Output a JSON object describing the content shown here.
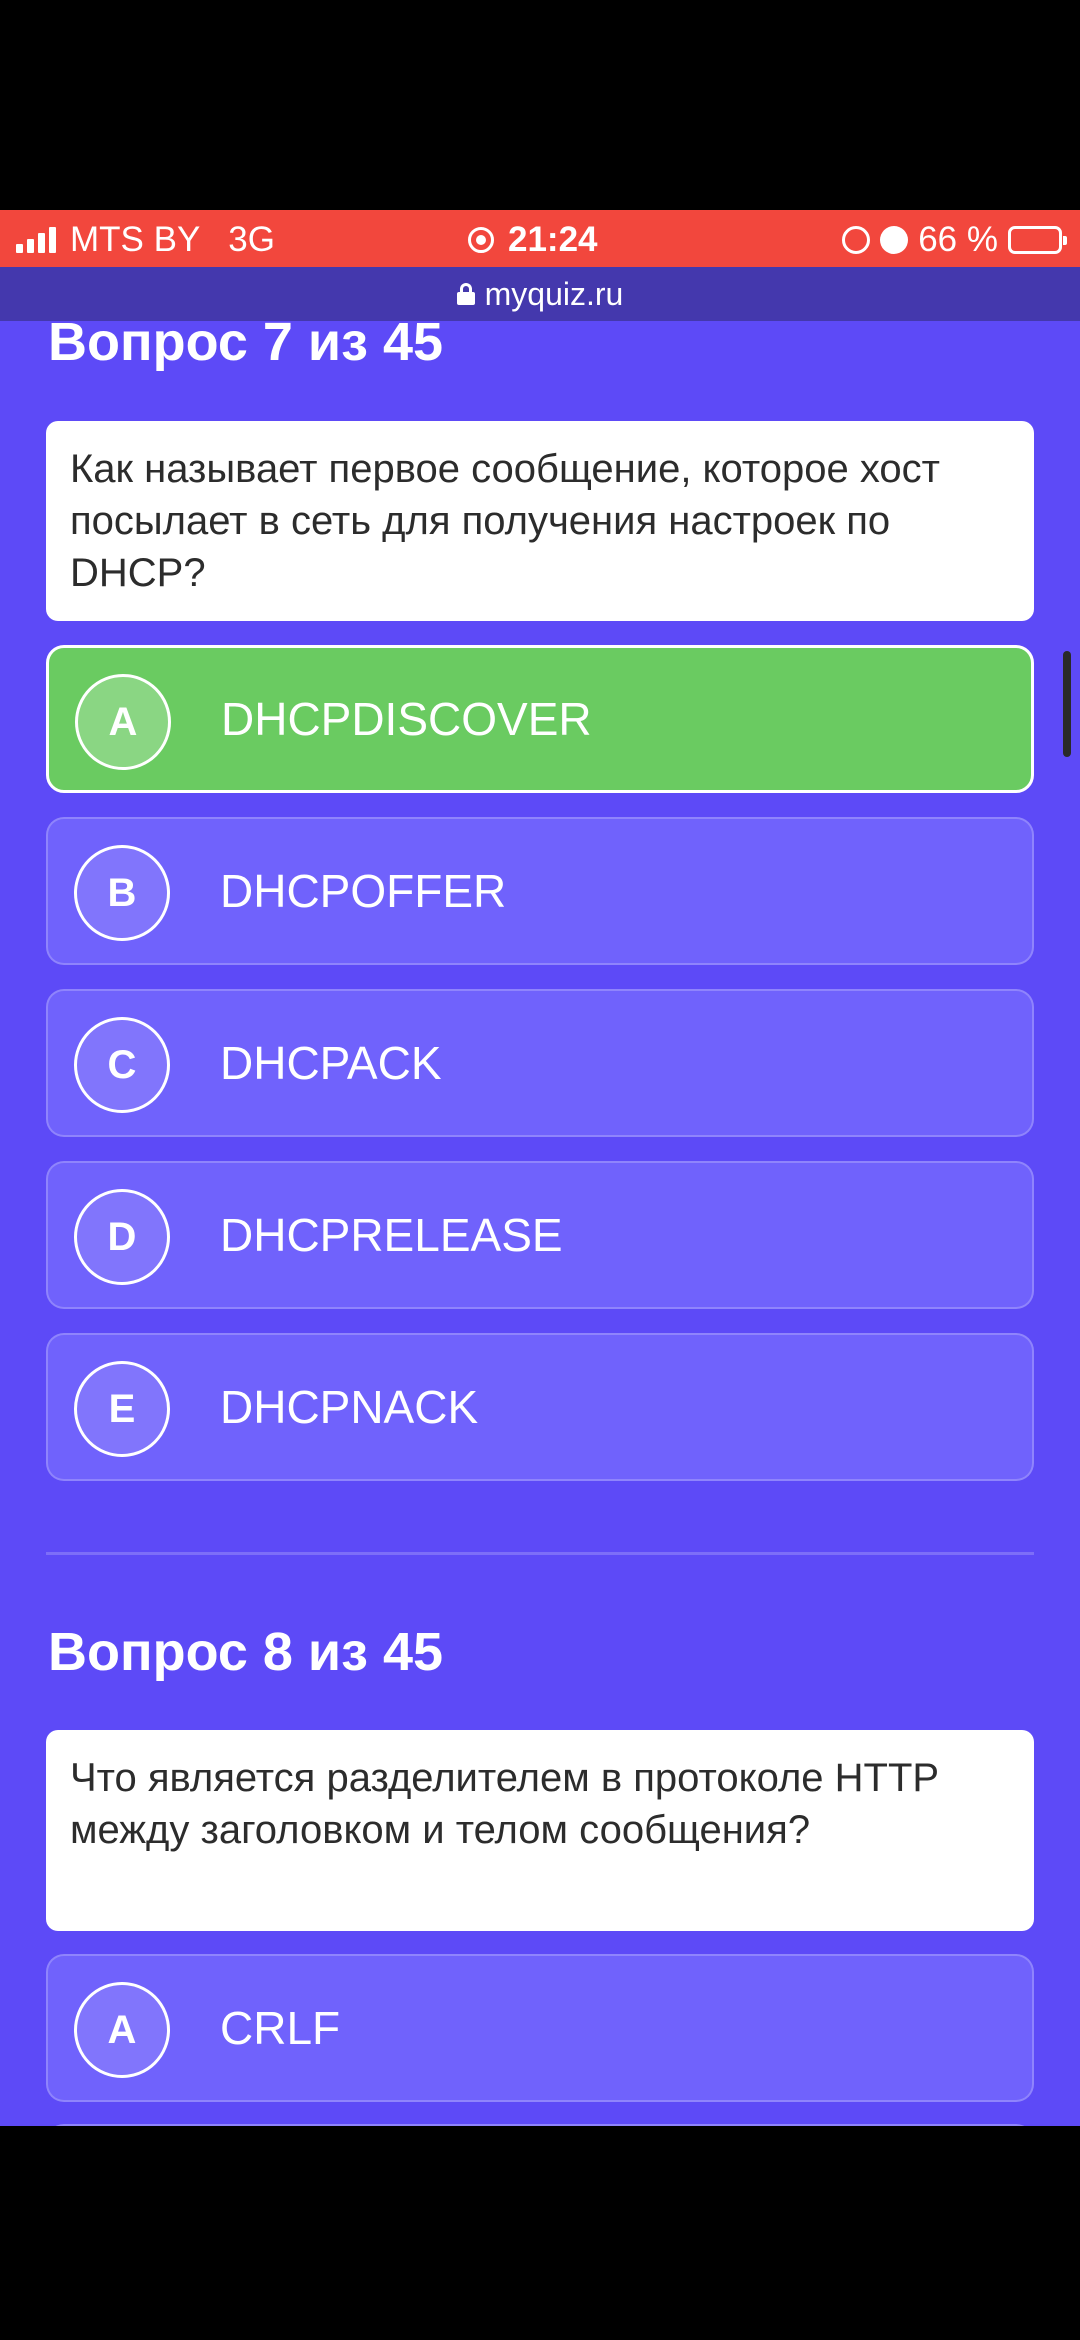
{
  "status_bar": {
    "carrier": "MTS BY",
    "network": "3G",
    "time": "21:24",
    "battery": "66 %",
    "battery_level": 0.66,
    "icons": [
      "signal-icon",
      "screen-record-icon",
      "rotation-lock-icon",
      "alarm-icon",
      "battery-icon"
    ]
  },
  "browser": {
    "url": "myquiz.ru"
  },
  "questions": [
    {
      "title": "Вопрос 7 из 45",
      "text": "Как называет первое сообщение, которое хост посылает в сеть для получения настроек по DHCP?",
      "options": [
        {
          "letter": "A",
          "text": "DHCPDISCOVER",
          "selected": true
        },
        {
          "letter": "B",
          "text": "DHCPOFFER",
          "selected": false
        },
        {
          "letter": "C",
          "text": "DHCPACK",
          "selected": false
        },
        {
          "letter": "D",
          "text": "DHCPRELEASE",
          "selected": false
        },
        {
          "letter": "E",
          "text": "DHCPNACK",
          "selected": false
        }
      ]
    },
    {
      "title": "Вопрос 8 из 45",
      "text": "Что является разделителем в протоколе HTTP между заголовком и телом сообщения?",
      "options": [
        {
          "letter": "A",
          "text": "CRLF",
          "selected": false
        }
      ]
    }
  ],
  "colors": {
    "status_bar": "#f2473d",
    "url_bar": "#4438ad",
    "page_background": "#5d4af7",
    "option_background": "#7062fc",
    "selected_option": "#6acb61"
  }
}
